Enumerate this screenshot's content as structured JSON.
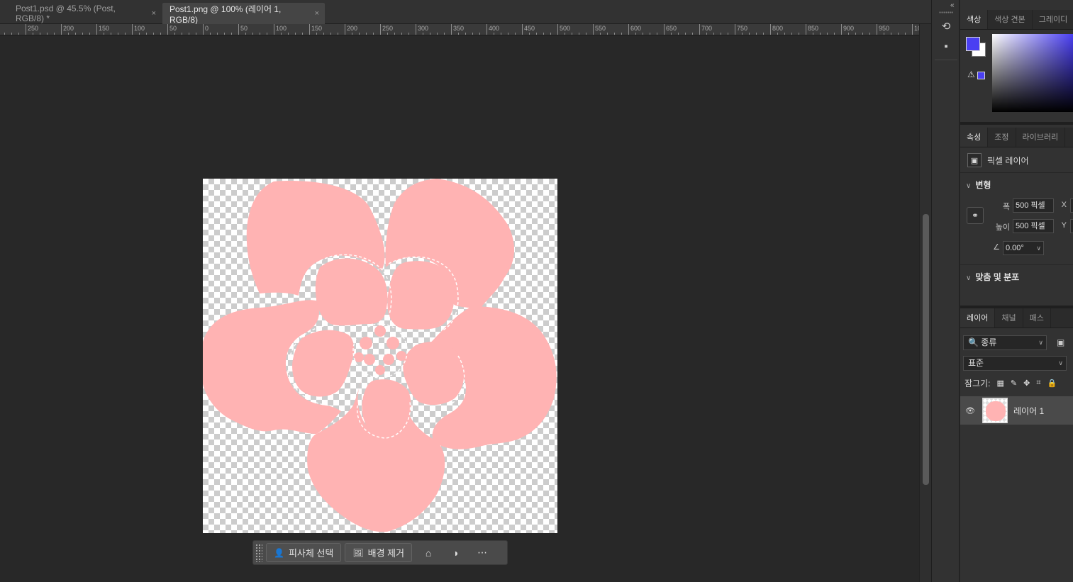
{
  "tabs": [
    {
      "label": "Post1.psd @ 45.5% (Post, RGB/8) *",
      "close": "×"
    },
    {
      "label": "Post1.png @ 100% (레이어 1, RGB/8)",
      "close": "×"
    }
  ],
  "ruler": {
    "labels": [
      "0",
      "250",
      "200",
      "150",
      "100",
      "50",
      "0",
      "50",
      "100",
      "150",
      "200",
      "250",
      "300",
      "350",
      "400",
      "450",
      "500",
      "550",
      "600",
      "650",
      "700",
      "750",
      "800",
      "850",
      "900",
      "950",
      "10"
    ]
  },
  "taskbar": {
    "select_subject": "피사체 선택",
    "remove_background": "배경 제거"
  },
  "panel_strip": {
    "collapse": "«"
  },
  "color_panel": {
    "tabs": [
      "색상",
      "색상 견본",
      "그레이디"
    ],
    "foreground": "#4a3ff2",
    "background": "#ffffff"
  },
  "properties_panel": {
    "tabs": [
      "속성",
      "조정",
      "라이브러리"
    ],
    "layer_type": "픽셀 레이어",
    "transform": {
      "title": "변형",
      "width_label": "폭",
      "width_value": "500 픽셀",
      "height_label": "높이",
      "height_value": "500 픽셀",
      "x_label": "X",
      "y_label": "Y",
      "angle_value": "0.00°"
    },
    "align": {
      "title": "맞춤 및 분포"
    }
  },
  "layers_panel": {
    "tabs": [
      "레이어",
      "채널",
      "패스"
    ],
    "filter_value": "종류",
    "blend_mode": "표준",
    "lock_label": "잠그기:",
    "layers": [
      {
        "name": "레이어 1"
      }
    ]
  },
  "colors": {
    "flower": "#ffb3b3",
    "app_bg": "#282828"
  }
}
